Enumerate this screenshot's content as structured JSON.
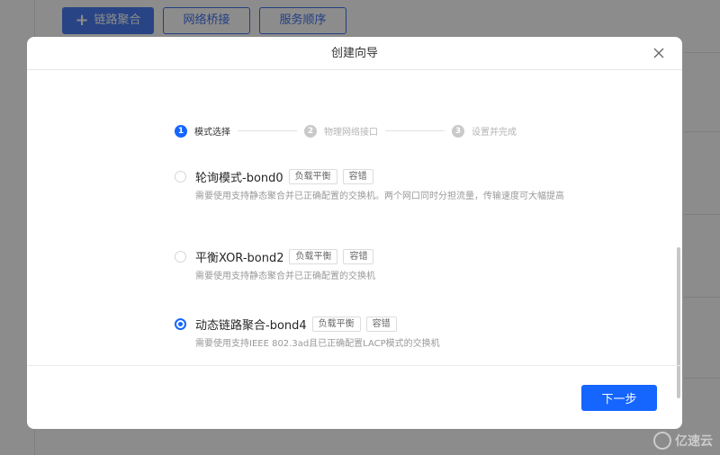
{
  "background": {
    "toolbar": {
      "add_bond_label": "链路聚合",
      "bridge_label": "网络桥接",
      "service_order_label": "服务顺序"
    }
  },
  "watermark": {
    "text": "亿速云"
  },
  "modal": {
    "title": "创建向导",
    "steps": [
      {
        "num": "1",
        "label": "模式选择",
        "active": true
      },
      {
        "num": "2",
        "label": "物理网络接口",
        "active": false
      },
      {
        "num": "3",
        "label": "设置并完成",
        "active": false
      }
    ],
    "options": [
      {
        "title": "轮询模式-bond0",
        "tags": [
          "负载平衡",
          "容错"
        ],
        "desc": "需要使用支持静态聚合并已正确配置的交换机。两个网口同时分担流量，传输速度可大幅提高",
        "checked": false
      },
      {
        "title": "平衡XOR-bond2",
        "tags": [
          "负载平衡",
          "容错"
        ],
        "desc": "需要使用支持静态聚合并已正确配置的交换机",
        "checked": false
      },
      {
        "title": "动态链路聚合-bond4",
        "tags": [
          "负载平衡",
          "容错"
        ],
        "desc": "需要使用支持IEEE 802.3ad且已正确配置LACP模式的交换机",
        "checked": true
      }
    ],
    "next_label": "下一步"
  },
  "colors": {
    "primary": "#1565ff",
    "toolbar_blue": "#3f73ef"
  }
}
